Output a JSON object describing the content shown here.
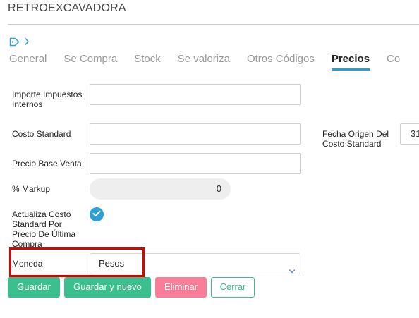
{
  "header": {
    "title": "RETROEXCAVADORA"
  },
  "tags": {
    "icon": "tag-icon",
    "chevron": "chevron-right-icon"
  },
  "tabs": [
    {
      "label": "General"
    },
    {
      "label": "Se Compra"
    },
    {
      "label": "Stock"
    },
    {
      "label": "Se valoriza"
    },
    {
      "label": "Otros Códigos"
    },
    {
      "label": "Precios"
    },
    {
      "label": "Co"
    }
  ],
  "active_tab": "Precios",
  "form": {
    "importe_label": "Importe Impuestos Internos",
    "importe_value": "",
    "costo_label": "Costo Standard",
    "costo_value": "",
    "fecha_label": "Fecha Origen Del Costo Standard",
    "fecha_value": "31",
    "precio_label": "Precio Base Venta",
    "precio_value": "",
    "markup_label": "% Markup",
    "markup_value": "0",
    "actualiza_label": "Actualiza Costo Standard Por Precio De Última Compra",
    "actualiza_checked": true,
    "moneda_label": "Moneda",
    "moneda_value": "Pesos"
  },
  "buttons": {
    "guardar": "Guardar",
    "guardar_nuevo": "Guardar y nuevo",
    "eliminar": "Eliminar",
    "cerrar": "Cerrar"
  },
  "colors": {
    "accent": "#2a9fd6",
    "primary_button": "#3cbf8f",
    "danger_button": "#f77d99",
    "highlight": "#e00000"
  }
}
